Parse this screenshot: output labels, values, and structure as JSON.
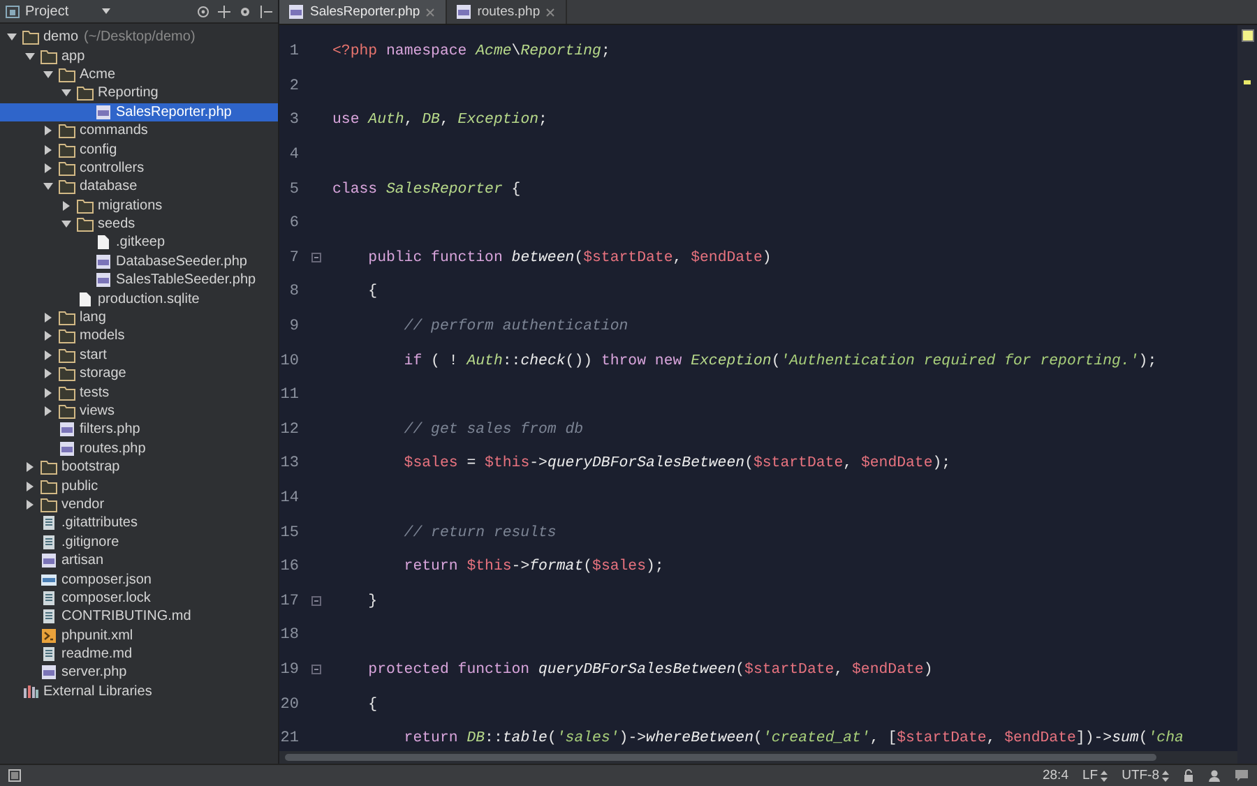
{
  "sidebar": {
    "title": "Project",
    "tree": [
      {
        "name": "demo",
        "hint": "(~/Desktop/demo)",
        "kind": "folder",
        "expanded": true,
        "selected": false,
        "children": [
          {
            "name": "app",
            "kind": "folder",
            "expanded": true,
            "selected": false,
            "children": [
              {
                "name": "Acme",
                "kind": "folder",
                "expanded": true,
                "selected": false,
                "children": [
                  {
                    "name": "Reporting",
                    "kind": "folder",
                    "expanded": true,
                    "selected": false,
                    "children": [
                      {
                        "name": "SalesReporter.php",
                        "kind": "php",
                        "selected": true
                      }
                    ]
                  }
                ]
              },
              {
                "name": "commands",
                "kind": "folder",
                "expanded": false,
                "selected": false
              },
              {
                "name": "config",
                "kind": "folder",
                "expanded": false,
                "selected": false
              },
              {
                "name": "controllers",
                "kind": "folder",
                "expanded": false,
                "selected": false
              },
              {
                "name": "database",
                "kind": "folder",
                "expanded": true,
                "selected": false,
                "children": [
                  {
                    "name": "migrations",
                    "kind": "folder",
                    "expanded": false,
                    "selected": false
                  },
                  {
                    "name": "seeds",
                    "kind": "folder",
                    "expanded": true,
                    "selected": false,
                    "children": [
                      {
                        "name": ".gitkeep",
                        "kind": "blank",
                        "selected": false
                      },
                      {
                        "name": "DatabaseSeeder.php",
                        "kind": "php",
                        "selected": false
                      },
                      {
                        "name": "SalesTableSeeder.php",
                        "kind": "php",
                        "selected": false
                      }
                    ]
                  },
                  {
                    "name": "production.sqlite",
                    "kind": "blank",
                    "selected": false
                  }
                ]
              },
              {
                "name": "lang",
                "kind": "folder",
                "expanded": false,
                "selected": false
              },
              {
                "name": "models",
                "kind": "folder",
                "expanded": false,
                "selected": false
              },
              {
                "name": "start",
                "kind": "folder",
                "expanded": false,
                "selected": false
              },
              {
                "name": "storage",
                "kind": "folder",
                "expanded": false,
                "selected": false
              },
              {
                "name": "tests",
                "kind": "folder",
                "expanded": false,
                "selected": false
              },
              {
                "name": "views",
                "kind": "folder",
                "expanded": false,
                "selected": false
              },
              {
                "name": "filters.php",
                "kind": "php",
                "selected": false
              },
              {
                "name": "routes.php",
                "kind": "php",
                "selected": false
              }
            ]
          },
          {
            "name": "bootstrap",
            "kind": "folder",
            "expanded": false,
            "selected": false
          },
          {
            "name": "public",
            "kind": "folder",
            "expanded": false,
            "selected": false
          },
          {
            "name": "vendor",
            "kind": "folder",
            "expanded": false,
            "selected": false
          },
          {
            "name": ".gitattributes",
            "kind": "text",
            "selected": false
          },
          {
            "name": ".gitignore",
            "kind": "text",
            "selected": false
          },
          {
            "name": "artisan",
            "kind": "php",
            "selected": false
          },
          {
            "name": "composer.json",
            "kind": "json",
            "selected": false
          },
          {
            "name": "composer.lock",
            "kind": "text",
            "selected": false
          },
          {
            "name": "CONTRIBUTING.md",
            "kind": "text",
            "selected": false
          },
          {
            "name": "phpunit.xml",
            "kind": "xml",
            "selected": false
          },
          {
            "name": "readme.md",
            "kind": "text",
            "selected": false
          },
          {
            "name": "server.php",
            "kind": "php",
            "selected": false
          }
        ]
      },
      {
        "name": "External Libraries",
        "kind": "library",
        "selected": false
      }
    ]
  },
  "tabs": [
    {
      "label": "SalesReporter.php",
      "selected": true
    },
    {
      "label": "routes.php",
      "selected": false
    }
  ],
  "code": [
    {
      "number": "1",
      "fold": false,
      "tokens": [
        {
          "kind": "tag",
          "text": "<?php"
        },
        {
          "kind": "keyword",
          "text": " namespace "
        },
        {
          "kind": "class",
          "text": "Acme"
        },
        {
          "kind": "plain",
          "text": "\\"
        },
        {
          "kind": "class",
          "text": "Reporting"
        },
        {
          "kind": "plain",
          "text": ";"
        }
      ]
    },
    {
      "number": "2",
      "fold": false
    },
    {
      "number": "3",
      "fold": false,
      "tokens": [
        {
          "kind": "keyword",
          "text": "use "
        },
        {
          "kind": "class",
          "text": "Auth"
        },
        {
          "kind": "plain",
          "text": ", "
        },
        {
          "kind": "class",
          "text": "DB"
        },
        {
          "kind": "plain",
          "text": ", "
        },
        {
          "kind": "class",
          "text": "Exception"
        },
        {
          "kind": "plain",
          "text": ";"
        }
      ]
    },
    {
      "number": "4",
      "fold": false
    },
    {
      "number": "5",
      "fold": false,
      "tokens": [
        {
          "kind": "keyword",
          "text": "class "
        },
        {
          "kind": "class",
          "text": "SalesReporter"
        },
        {
          "kind": "plain",
          "text": " {"
        }
      ]
    },
    {
      "number": "6",
      "fold": false
    },
    {
      "number": "7",
      "fold": true,
      "tokens": [
        {
          "kind": "keyword",
          "text": "    public function "
        },
        {
          "kind": "function",
          "text": "between"
        },
        {
          "kind": "plain",
          "text": "("
        },
        {
          "kind": "variable",
          "text": "$startDate"
        },
        {
          "kind": "plain",
          "text": ", "
        },
        {
          "kind": "variable",
          "text": "$endDate"
        },
        {
          "kind": "plain",
          "text": ")"
        }
      ]
    },
    {
      "number": "8",
      "fold": false,
      "tokens": [
        {
          "kind": "plain",
          "text": "    {"
        }
      ]
    },
    {
      "number": "9",
      "fold": false,
      "tokens": [
        {
          "kind": "comment",
          "text": "        // perform authentication"
        }
      ]
    },
    {
      "number": "10",
      "fold": false,
      "tokens": [
        {
          "kind": "keyword",
          "text": "        if"
        },
        {
          "kind": "plain",
          "text": " ( ! "
        },
        {
          "kind": "class",
          "text": "Auth"
        },
        {
          "kind": "plain",
          "text": "::"
        },
        {
          "kind": "function",
          "text": "check"
        },
        {
          "kind": "plain",
          "text": "()) "
        },
        {
          "kind": "keyword",
          "text": "throw new "
        },
        {
          "kind": "class",
          "text": "Exception"
        },
        {
          "kind": "plain",
          "text": "("
        },
        {
          "kind": "string",
          "text": "'Authentication required for reporting.'"
        },
        {
          "kind": "plain",
          "text": ");"
        }
      ]
    },
    {
      "number": "11",
      "fold": false
    },
    {
      "number": "12",
      "fold": false,
      "tokens": [
        {
          "kind": "comment",
          "text": "        // get sales from db"
        }
      ]
    },
    {
      "number": "13",
      "fold": false,
      "tokens": [
        {
          "kind": "variable",
          "text": "        $sales"
        },
        {
          "kind": "plain",
          "text": " = "
        },
        {
          "kind": "variable",
          "text": "$this"
        },
        {
          "kind": "plain",
          "text": "->"
        },
        {
          "kind": "function",
          "text": "queryDBForSalesBetween"
        },
        {
          "kind": "plain",
          "text": "("
        },
        {
          "kind": "variable",
          "text": "$startDate"
        },
        {
          "kind": "plain",
          "text": ", "
        },
        {
          "kind": "variable",
          "text": "$endDate"
        },
        {
          "kind": "plain",
          "text": ");"
        }
      ]
    },
    {
      "number": "14",
      "fold": false
    },
    {
      "number": "15",
      "fold": false,
      "tokens": [
        {
          "kind": "comment",
          "text": "        // return results"
        }
      ]
    },
    {
      "number": "16",
      "fold": false,
      "tokens": [
        {
          "kind": "keyword",
          "text": "        return "
        },
        {
          "kind": "variable",
          "text": "$this"
        },
        {
          "kind": "plain",
          "text": "->"
        },
        {
          "kind": "function",
          "text": "format"
        },
        {
          "kind": "plain",
          "text": "("
        },
        {
          "kind": "variable",
          "text": "$sales"
        },
        {
          "kind": "plain",
          "text": ");"
        }
      ]
    },
    {
      "number": "17",
      "fold": true,
      "tokens": [
        {
          "kind": "plain",
          "text": "    }"
        }
      ]
    },
    {
      "number": "18",
      "fold": false
    },
    {
      "number": "19",
      "fold": true,
      "tokens": [
        {
          "kind": "keyword",
          "text": "    protected function "
        },
        {
          "kind": "function",
          "text": "queryDBForSalesBetween"
        },
        {
          "kind": "plain",
          "text": "("
        },
        {
          "kind": "variable",
          "text": "$startDate"
        },
        {
          "kind": "plain",
          "text": ", "
        },
        {
          "kind": "variable",
          "text": "$endDate"
        },
        {
          "kind": "plain",
          "text": ")"
        }
      ]
    },
    {
      "number": "20",
      "fold": false,
      "tokens": [
        {
          "kind": "plain",
          "text": "    {"
        }
      ]
    },
    {
      "number": "21",
      "fold": false,
      "tokens": [
        {
          "kind": "keyword",
          "text": "        return "
        },
        {
          "kind": "class",
          "text": "DB"
        },
        {
          "kind": "plain",
          "text": "::"
        },
        {
          "kind": "function",
          "text": "table"
        },
        {
          "kind": "plain",
          "text": "("
        },
        {
          "kind": "string",
          "text": "'sales'"
        },
        {
          "kind": "plain",
          "text": ")->"
        },
        {
          "kind": "function",
          "text": "whereBetween"
        },
        {
          "kind": "plain",
          "text": "("
        },
        {
          "kind": "string",
          "text": "'created_at'"
        },
        {
          "kind": "plain",
          "text": ", ["
        },
        {
          "kind": "variable",
          "text": "$startDate"
        },
        {
          "kind": "plain",
          "text": ", "
        },
        {
          "kind": "variable",
          "text": "$endDate"
        },
        {
          "kind": "plain",
          "text": "])->"
        },
        {
          "kind": "function",
          "text": "sum"
        },
        {
          "kind": "plain",
          "text": "("
        },
        {
          "kind": "string",
          "text": "'cha"
        }
      ]
    }
  ],
  "status_bar": {
    "position": "28:4",
    "line_ending": "LF",
    "encoding": "UTF-8"
  }
}
